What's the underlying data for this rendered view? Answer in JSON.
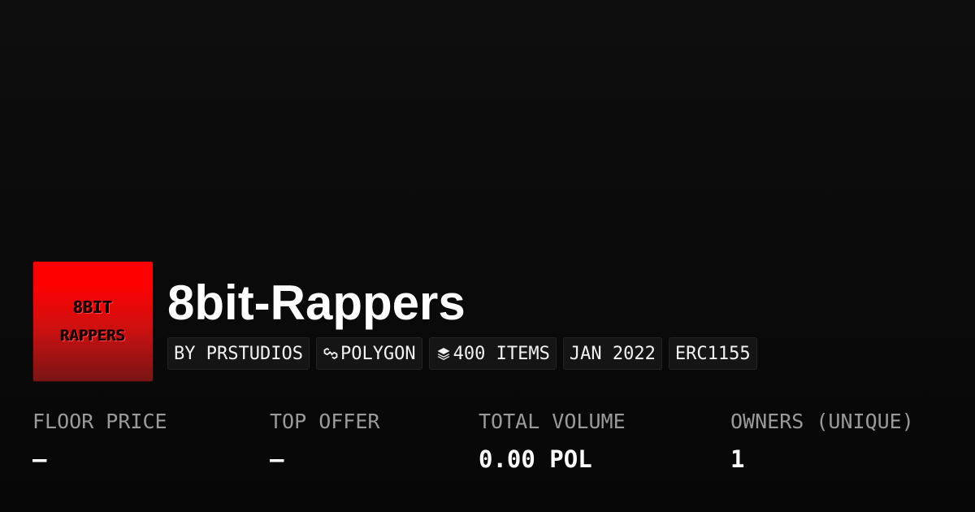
{
  "collection": {
    "logo_text_line1": "8BIT",
    "logo_text_line2": "RAPPERS",
    "title": "8bit-Rappers",
    "tags": [
      {
        "label": "BY PRSTUDIOS",
        "icon": null
      },
      {
        "label": "POLYGON",
        "icon": "polygon-chain-icon"
      },
      {
        "label": "400 ITEMS",
        "icon": "layers-icon"
      },
      {
        "label": "JAN 2022",
        "icon": null
      },
      {
        "label": "ERC1155",
        "icon": null
      }
    ]
  },
  "stats": [
    {
      "label": "FLOOR PRICE",
      "value": "—"
    },
    {
      "label": "TOP OFFER",
      "value": "—"
    },
    {
      "label": "TOTAL VOLUME",
      "value": "0.00 POL"
    },
    {
      "label": "OWNERS (UNIQUE)",
      "value": "1"
    }
  ],
  "colors": {
    "background": "#0b0b0b",
    "logo_red": "#ff0000",
    "tag_background": "#151515",
    "label_gray": "#9a9a9a",
    "text_white": "#ffffff"
  }
}
